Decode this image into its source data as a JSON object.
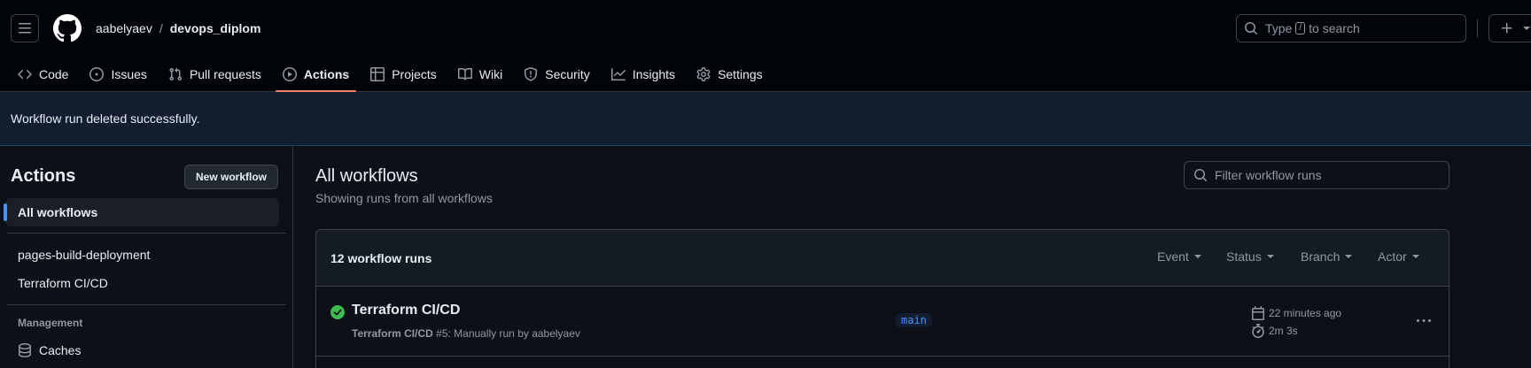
{
  "header": {
    "owner": "aabelyaev",
    "separator": "/",
    "repo": "devops_diplom",
    "search_prefix": "Type",
    "search_key": "/",
    "search_suffix": "to search"
  },
  "nav": {
    "tabs": [
      {
        "label": "Code",
        "icon": "code-icon"
      },
      {
        "label": "Issues",
        "icon": "issue-icon"
      },
      {
        "label": "Pull requests",
        "icon": "pull-request-icon"
      },
      {
        "label": "Actions",
        "icon": "play-icon",
        "selected": true
      },
      {
        "label": "Projects",
        "icon": "table-icon"
      },
      {
        "label": "Wiki",
        "icon": "book-icon"
      },
      {
        "label": "Security",
        "icon": "shield-icon"
      },
      {
        "label": "Insights",
        "icon": "graph-icon"
      },
      {
        "label": "Settings",
        "icon": "gear-icon"
      }
    ]
  },
  "flash": {
    "message": "Workflow run deleted successfully."
  },
  "sidebar": {
    "title": "Actions",
    "new_workflow": "New workflow",
    "items": [
      {
        "label": "All workflows",
        "active": true
      },
      {
        "label": "pages-build-deployment"
      },
      {
        "label": "Terraform CI/CD"
      }
    ],
    "management_heading": "Management",
    "caches": "Caches"
  },
  "main": {
    "title": "All workflows",
    "subtitle": "Showing runs from all workflows",
    "filter_placeholder": "Filter workflow runs",
    "runs_count": "12 workflow runs",
    "filters": [
      "Event",
      "Status",
      "Branch",
      "Actor"
    ],
    "runs": [
      {
        "title": "Terraform CI/CD",
        "workflow": "Terraform CI/CD",
        "detail": "#5: Manually run by aabelyaev",
        "branch": "main",
        "time_ago": "22 minutes ago",
        "duration": "2m 3s",
        "status": "success"
      }
    ]
  },
  "colors": {
    "accent": "#f78166",
    "link": "#4493f8",
    "success": "#3fb950",
    "flash_bg": "#121d2f"
  }
}
